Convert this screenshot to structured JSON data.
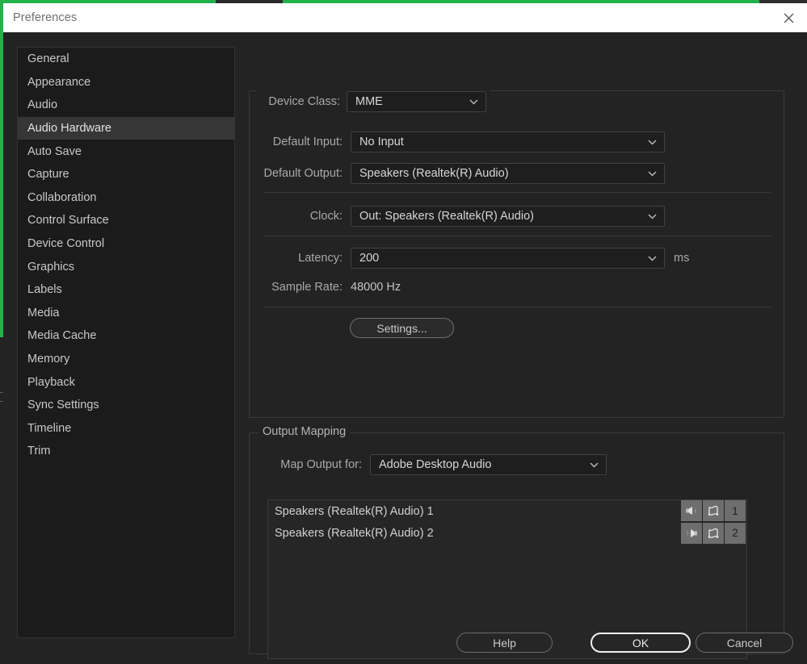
{
  "window": {
    "title": "Preferences",
    "close_icon": "close-icon",
    "accent_color": "#22b24c"
  },
  "sidebar": {
    "items": [
      {
        "label": "General",
        "selected": false
      },
      {
        "label": "Appearance",
        "selected": false
      },
      {
        "label": "Audio",
        "selected": false
      },
      {
        "label": "Audio Hardware",
        "selected": true
      },
      {
        "label": "Auto Save",
        "selected": false
      },
      {
        "label": "Capture",
        "selected": false
      },
      {
        "label": "Collaboration",
        "selected": false
      },
      {
        "label": "Control Surface",
        "selected": false
      },
      {
        "label": "Device Control",
        "selected": false
      },
      {
        "label": "Graphics",
        "selected": false
      },
      {
        "label": "Labels",
        "selected": false
      },
      {
        "label": "Media",
        "selected": false
      },
      {
        "label": "Media Cache",
        "selected": false
      },
      {
        "label": "Memory",
        "selected": false
      },
      {
        "label": "Playback",
        "selected": false
      },
      {
        "label": "Sync Settings",
        "selected": false
      },
      {
        "label": "Timeline",
        "selected": false
      },
      {
        "label": "Trim",
        "selected": false
      }
    ]
  },
  "device_settings": {
    "device_class": {
      "label": "Device Class:",
      "value": "MME"
    },
    "default_input": {
      "label": "Default Input:",
      "value": "No Input"
    },
    "default_output": {
      "label": "Default Output:",
      "value": "Speakers (Realtek(R) Audio)"
    },
    "clock": {
      "label": "Clock:",
      "value": "Out: Speakers (Realtek(R) Audio)"
    },
    "latency": {
      "label": "Latency:",
      "value": "200",
      "units": "ms"
    },
    "sample_rate": {
      "label": "Sample Rate:",
      "value": "48000 Hz"
    },
    "settings_button": "Settings..."
  },
  "output_mapping": {
    "legend": "Output Mapping",
    "map_output_for": {
      "label": "Map Output for:",
      "value": "Adobe Desktop Audio"
    },
    "rows": [
      {
        "label": "Speakers (Realtek(R) Audio) 1",
        "pan_icon": "speaker-left-icon",
        "track_icon": "clip-mapping-icon",
        "channel": "1"
      },
      {
        "label": "Speakers (Realtek(R) Audio) 2",
        "pan_icon": "speaker-right-icon",
        "track_icon": "clip-mapping-icon",
        "channel": "2"
      }
    ]
  },
  "buttons": {
    "help": "Help",
    "ok": "OK",
    "cancel": "Cancel"
  }
}
